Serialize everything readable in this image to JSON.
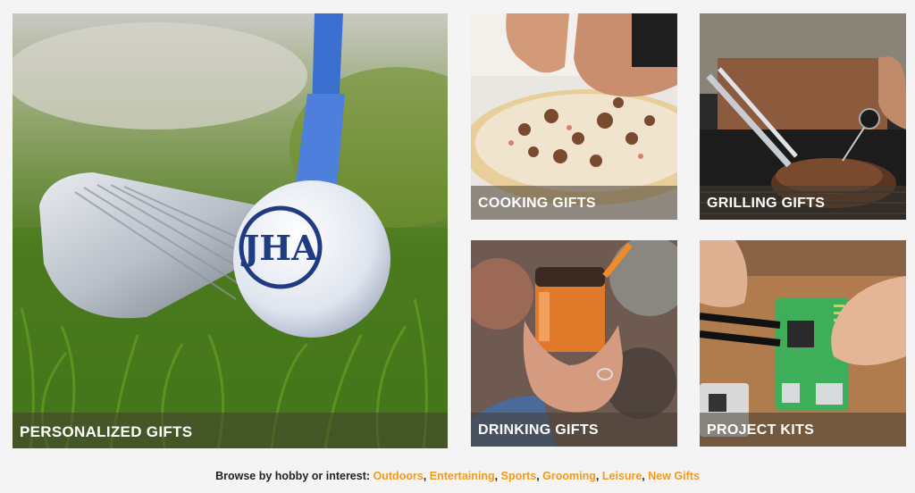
{
  "tiles": {
    "personalized": {
      "label": "PERSONALIZED GIFTS",
      "monogram": "JHA"
    },
    "cooking": {
      "label": "COOKING GIFTS"
    },
    "grilling": {
      "label": "GRILLING GIFTS"
    },
    "drinking": {
      "label": "DRINKING GIFTS"
    },
    "project": {
      "label": "PROJECT KITS"
    }
  },
  "browse": {
    "prefix": "Browse by hobby or interest:",
    "links": [
      "Outdoors",
      "Entertaining",
      "Sports",
      "Grooming",
      "Leisure",
      "New Gifts"
    ],
    "link_color": "#f29a1d"
  }
}
